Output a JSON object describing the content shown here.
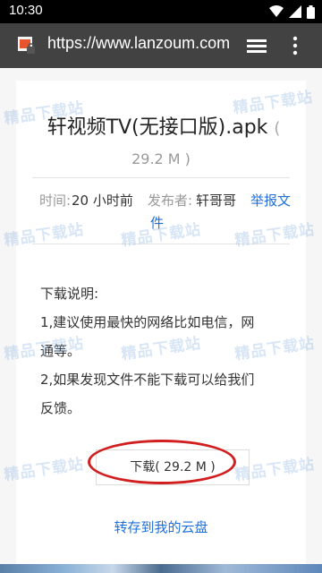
{
  "status_bar": {
    "time": "10:30"
  },
  "toolbar": {
    "url": "https://www.lanzoum.com"
  },
  "file": {
    "name": "轩视频TV(无接口版).apk",
    "size_paren_open": "(",
    "size": "29.2 M )",
    "time_label": "时间:",
    "time_value": "20 小时前",
    "publisher_label": "发布者:",
    "publisher_value": "轩哥哥",
    "report_line1": "举报文",
    "report_line2": "件"
  },
  "description": {
    "heading": "下载说明:",
    "line1": "1,建议使用最快的网络比如电信，网",
    "line2": "通等。",
    "line3": "2,如果发现文件不能下载可以给我们",
    "line4": "反馈。"
  },
  "download_button": {
    "label": "下载( 29.2 M )"
  },
  "save_link": {
    "label": "转存到我的云盘"
  },
  "watermark": {
    "text": "精品下载站"
  }
}
